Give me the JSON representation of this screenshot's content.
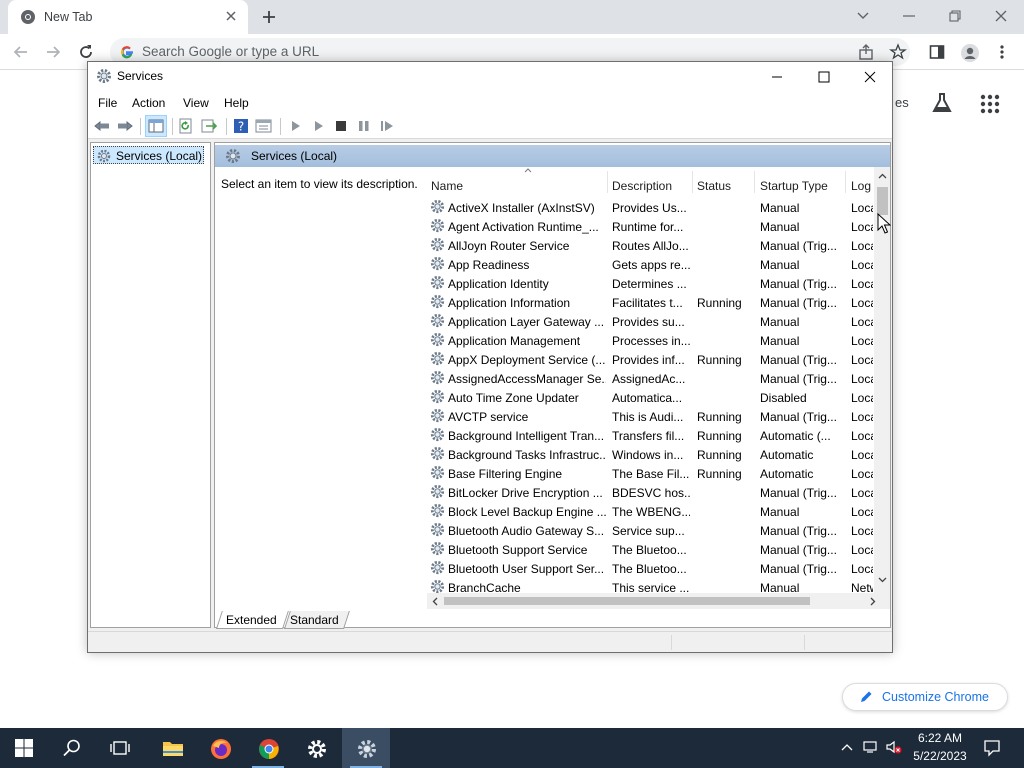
{
  "chrome": {
    "tab_title": "New Tab",
    "omnibox_placeholder": "Search Google or type a URL",
    "partial_shortcut_text": "es",
    "customize_label": "Customize Chrome"
  },
  "services_window": {
    "title": "Services",
    "menu": [
      "File",
      "Action",
      "View",
      "Help"
    ],
    "tree_item": "Services (Local)",
    "header_title": "Services (Local)",
    "description_hint": "Select an item to view its description.",
    "columns": [
      "Name",
      "Description",
      "Status",
      "Startup Type",
      "Log"
    ],
    "rows": [
      {
        "name": "ActiveX Installer (AxInstSV)",
        "description": "Provides Us...",
        "status": "",
        "startup": "Manual",
        "log": "Loca"
      },
      {
        "name": "Agent Activation Runtime_...",
        "description": "Runtime for...",
        "status": "",
        "startup": "Manual",
        "log": "Loca"
      },
      {
        "name": "AllJoyn Router Service",
        "description": "Routes AllJo...",
        "status": "",
        "startup": "Manual (Trig...",
        "log": "Loca"
      },
      {
        "name": "App Readiness",
        "description": "Gets apps re...",
        "status": "",
        "startup": "Manual",
        "log": "Loca"
      },
      {
        "name": "Application Identity",
        "description": "Determines ...",
        "status": "",
        "startup": "Manual (Trig...",
        "log": "Loca"
      },
      {
        "name": "Application Information",
        "description": "Facilitates t...",
        "status": "Running",
        "startup": "Manual (Trig...",
        "log": "Loca"
      },
      {
        "name": "Application Layer Gateway ...",
        "description": "Provides su...",
        "status": "",
        "startup": "Manual",
        "log": "Loca"
      },
      {
        "name": "Application Management",
        "description": "Processes in...",
        "status": "",
        "startup": "Manual",
        "log": "Loca"
      },
      {
        "name": "AppX Deployment Service (...",
        "description": "Provides inf...",
        "status": "Running",
        "startup": "Manual (Trig...",
        "log": "Loca"
      },
      {
        "name": "AssignedAccessManager Se...",
        "description": "AssignedAc...",
        "status": "",
        "startup": "Manual (Trig...",
        "log": "Loca"
      },
      {
        "name": "Auto Time Zone Updater",
        "description": "Automatica...",
        "status": "",
        "startup": "Disabled",
        "log": "Loca"
      },
      {
        "name": "AVCTP service",
        "description": "This is Audi...",
        "status": "Running",
        "startup": "Manual (Trig...",
        "log": "Loca"
      },
      {
        "name": "Background Intelligent Tran...",
        "description": "Transfers fil...",
        "status": "Running",
        "startup": "Automatic (...",
        "log": "Loca"
      },
      {
        "name": "Background Tasks Infrastruc...",
        "description": "Windows in...",
        "status": "Running",
        "startup": "Automatic",
        "log": "Loca"
      },
      {
        "name": "Base Filtering Engine",
        "description": "The Base Fil...",
        "status": "Running",
        "startup": "Automatic",
        "log": "Loca"
      },
      {
        "name": "BitLocker Drive Encryption ...",
        "description": "BDESVC hos...",
        "status": "",
        "startup": "Manual (Trig...",
        "log": "Loca"
      },
      {
        "name": "Block Level Backup Engine ...",
        "description": "The WBENG...",
        "status": "",
        "startup": "Manual",
        "log": "Loca"
      },
      {
        "name": "Bluetooth Audio Gateway S...",
        "description": "Service sup...",
        "status": "",
        "startup": "Manual (Trig...",
        "log": "Loca"
      },
      {
        "name": "Bluetooth Support Service",
        "description": "The Bluetoo...",
        "status": "",
        "startup": "Manual (Trig...",
        "log": "Loca"
      },
      {
        "name": "Bluetooth User Support Ser...",
        "description": "The Bluetoo...",
        "status": "",
        "startup": "Manual (Trig...",
        "log": "Loca"
      },
      {
        "name": "BranchCache",
        "description": "This service ...",
        "status": "",
        "startup": "Manual",
        "log": "Netw"
      }
    ],
    "tabs": [
      "Extended",
      "Standard"
    ]
  },
  "taskbar": {
    "time": "6:22 AM",
    "date": "5/22/2023"
  },
  "colors": {
    "taskbar_bg": "#1c2a3a",
    "chrome_accent": "#1a73e8",
    "panel_header": "#a3bedd",
    "tree_selected": "#cce8ff"
  }
}
